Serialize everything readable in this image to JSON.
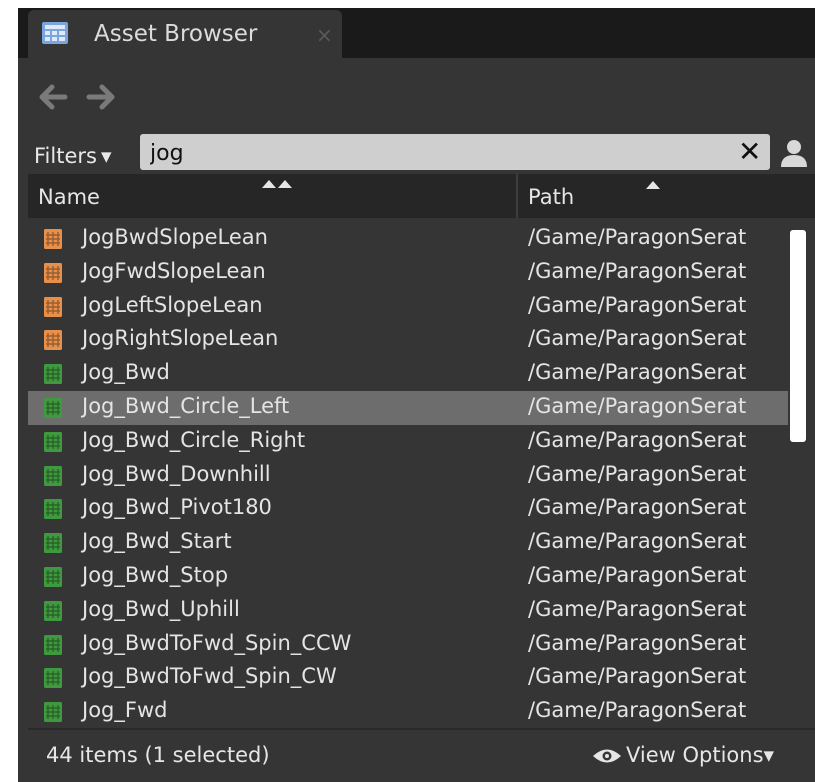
{
  "tab": {
    "title": "Asset Browser",
    "close_glyph": "×",
    "icon": "asset-grid-icon"
  },
  "nav": {
    "back_icon": "arrow-left-icon",
    "forward_icon": "arrow-right-icon"
  },
  "filter_bar": {
    "filters_label": "Filters",
    "filters_caret": "▾",
    "search_value": "jog",
    "clear_glyph": "✕",
    "person_icon": "person-icon"
  },
  "table": {
    "columns": {
      "name": "Name",
      "path": "Path"
    },
    "rows": [
      {
        "name": "JogBwdSlopeLean",
        "path": "/Game/ParagonSerat",
        "icon_color": "#e8904a",
        "selected": false
      },
      {
        "name": "JogFwdSlopeLean",
        "path": "/Game/ParagonSerat",
        "icon_color": "#e8904a",
        "selected": false
      },
      {
        "name": "JogLeftSlopeLean",
        "path": "/Game/ParagonSerat",
        "icon_color": "#e8904a",
        "selected": false
      },
      {
        "name": "JogRightSlopeLean",
        "path": "/Game/ParagonSerat",
        "icon_color": "#e8904a",
        "selected": false
      },
      {
        "name": "Jog_Bwd",
        "path": "/Game/ParagonSerat",
        "icon_color": "#3f9a3f",
        "selected": false
      },
      {
        "name": "Jog_Bwd_Circle_Left",
        "path": "/Game/ParagonSerat",
        "icon_color": "#3f9a3f",
        "selected": true
      },
      {
        "name": "Jog_Bwd_Circle_Right",
        "path": "/Game/ParagonSerat",
        "icon_color": "#3f9a3f",
        "selected": false
      },
      {
        "name": "Jog_Bwd_Downhill",
        "path": "/Game/ParagonSerat",
        "icon_color": "#3f9a3f",
        "selected": false
      },
      {
        "name": "Jog_Bwd_Pivot180",
        "path": "/Game/ParagonSerat",
        "icon_color": "#3f9a3f",
        "selected": false
      },
      {
        "name": "Jog_Bwd_Start",
        "path": "/Game/ParagonSerat",
        "icon_color": "#3f9a3f",
        "selected": false
      },
      {
        "name": "Jog_Bwd_Stop",
        "path": "/Game/ParagonSerat",
        "icon_color": "#3f9a3f",
        "selected": false
      },
      {
        "name": "Jog_Bwd_Uphill",
        "path": "/Game/ParagonSerat",
        "icon_color": "#3f9a3f",
        "selected": false
      },
      {
        "name": "Jog_BwdToFwd_Spin_CCW",
        "path": "/Game/ParagonSerat",
        "icon_color": "#3f9a3f",
        "selected": false
      },
      {
        "name": "Jog_BwdToFwd_Spin_CW",
        "path": "/Game/ParagonSerat",
        "icon_color": "#3f9a3f",
        "selected": false
      },
      {
        "name": "Jog_Fwd",
        "path": "/Game/ParagonSerat",
        "icon_color": "#3f9a3f",
        "selected": false
      }
    ]
  },
  "footer": {
    "status": "44 items (1 selected)",
    "view_options_label": "View Options",
    "view_options_caret": "▾",
    "eye_icon": "eye-icon"
  },
  "colors": {
    "panel": "#353535",
    "header": "#262626",
    "selected_row": "#6d6d6d",
    "search_bg": "#cfcfcf"
  }
}
